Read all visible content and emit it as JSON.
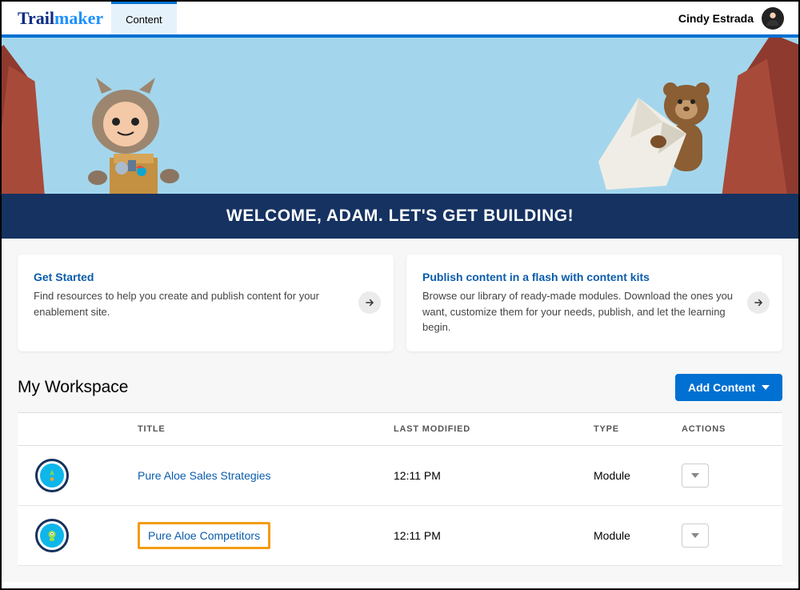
{
  "header": {
    "logo_trail": "Trail",
    "logo_maker": "maker",
    "tab_content": "Content",
    "username": "Cindy Estrada"
  },
  "welcome": "WELCOME, ADAM. LET'S GET BUILDING!",
  "cards": [
    {
      "title": "Get Started",
      "body": "Find resources to help you create and publish content for your enablement site."
    },
    {
      "title": "Publish content in a flash with content kits",
      "body": "Browse our library of ready-made modules. Download the ones you want, customize them for your needs, publish, and let the learning begin."
    }
  ],
  "workspace": {
    "title": "My Workspace",
    "add_button": "Add Content",
    "columns": {
      "title": "TITLE",
      "last_modified": "LAST MODIFIED",
      "type": "TYPE",
      "actions": "ACTIONS"
    },
    "rows": [
      {
        "title": "Pure Aloe Sales Strategies",
        "last_modified": "12:11 PM",
        "type": "Module",
        "highlight": false
      },
      {
        "title": "Pure Aloe Competitors",
        "last_modified": "12:11 PM",
        "type": "Module",
        "highlight": true
      }
    ]
  }
}
